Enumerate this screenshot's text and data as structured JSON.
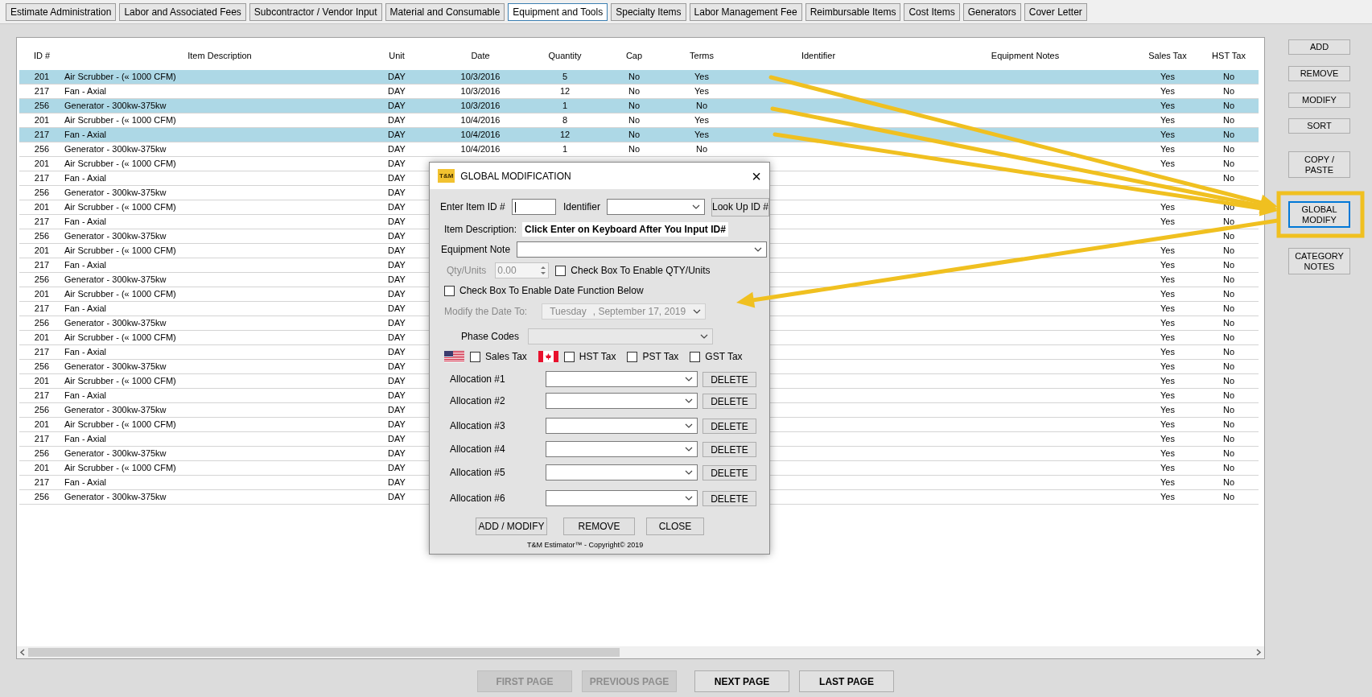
{
  "tabs": [
    {
      "label": "Estimate Administration",
      "selected": false
    },
    {
      "label": "Labor and Associated Fees",
      "selected": false
    },
    {
      "label": "Subcontractor / Vendor Input",
      "selected": false
    },
    {
      "label": "Material and Consumable",
      "selected": false
    },
    {
      "label": "Equipment and Tools",
      "selected": true
    },
    {
      "label": "Specialty Items",
      "selected": false
    },
    {
      "label": "Labor Management Fee",
      "selected": false
    },
    {
      "label": "Reimbursable Items",
      "selected": false
    },
    {
      "label": "Cost Items",
      "selected": false
    },
    {
      "label": "Generators",
      "selected": false
    },
    {
      "label": "Cover Letter",
      "selected": false
    }
  ],
  "table": {
    "columns": [
      "ID #",
      "Item Description",
      "Unit",
      "Date",
      "Quantity",
      "Cap",
      "Terms",
      "Identifier",
      "Equipment Notes",
      "Sales Tax",
      "HST Tax"
    ],
    "rows": [
      {
        "id": "201",
        "description": "Air Scrubber - (« 1000 CFM)",
        "unit": "DAY",
        "date": "10/3/2016",
        "quantity": "5",
        "cap": "No",
        "terms": "Yes",
        "sales_tax": "Yes",
        "hst_tax": "No",
        "selected": true
      },
      {
        "id": "217",
        "description": "Fan - Axial",
        "unit": "DAY",
        "date": "10/3/2016",
        "quantity": "12",
        "cap": "No",
        "terms": "Yes",
        "sales_tax": "Yes",
        "hst_tax": "No",
        "selected": false
      },
      {
        "id": "256",
        "description": "Generator - 300kw-375kw",
        "unit": "DAY",
        "date": "10/3/2016",
        "quantity": "1",
        "cap": "No",
        "terms": "No",
        "sales_tax": "Yes",
        "hst_tax": "No",
        "selected": true
      },
      {
        "id": "201",
        "description": "Air Scrubber - (« 1000 CFM)",
        "unit": "DAY",
        "date": "10/4/2016",
        "quantity": "8",
        "cap": "No",
        "terms": "Yes",
        "sales_tax": "Yes",
        "hst_tax": "No",
        "selected": false
      },
      {
        "id": "217",
        "description": "Fan - Axial",
        "unit": "DAY",
        "date": "10/4/2016",
        "quantity": "12",
        "cap": "No",
        "terms": "Yes",
        "sales_tax": "Yes",
        "hst_tax": "No",
        "selected": true
      },
      {
        "id": "256",
        "description": "Generator - 300kw-375kw",
        "unit": "DAY",
        "date": "10/4/2016",
        "quantity": "1",
        "cap": "No",
        "terms": "No",
        "sales_tax": "Yes",
        "hst_tax": "No",
        "selected": false
      },
      {
        "id": "201",
        "description": "Air Scrubber - (« 1000 CFM)",
        "unit": "DAY",
        "sales_tax": "Yes",
        "hst_tax": "No",
        "selected": false
      },
      {
        "id": "217",
        "description": "Fan - Axial",
        "unit": "DAY",
        "hst_tax": "No",
        "selected": false
      },
      {
        "id": "256",
        "description": "Generator - 300kw-375kw",
        "unit": "DAY",
        "selected": false
      },
      {
        "id": "201",
        "description": "Air Scrubber - (« 1000 CFM)",
        "unit": "DAY",
        "sales_tax": "Yes",
        "hst_tax": "No",
        "selected": false
      },
      {
        "id": "217",
        "description": "Fan - Axial",
        "unit": "DAY",
        "sales_tax": "Yes",
        "hst_tax": "No",
        "selected": false
      },
      {
        "id": "256",
        "description": "Generator - 300kw-375kw",
        "unit": "DAY",
        "hst_tax": "No",
        "selected": false
      },
      {
        "id": "201",
        "description": "Air Scrubber - (« 1000 CFM)",
        "unit": "DAY",
        "sales_tax": "Yes",
        "hst_tax": "No",
        "selected": false
      },
      {
        "id": "217",
        "description": "Fan - Axial",
        "unit": "DAY",
        "sales_tax": "Yes",
        "hst_tax": "No",
        "selected": false
      },
      {
        "id": "256",
        "description": "Generator - 300kw-375kw",
        "unit": "DAY",
        "sales_tax": "Yes",
        "hst_tax": "No",
        "selected": false
      },
      {
        "id": "201",
        "description": "Air Scrubber - (« 1000 CFM)",
        "unit": "DAY",
        "sales_tax": "Yes",
        "hst_tax": "No",
        "selected": false
      },
      {
        "id": "217",
        "description": "Fan - Axial",
        "unit": "DAY",
        "sales_tax": "Yes",
        "hst_tax": "No",
        "selected": false
      },
      {
        "id": "256",
        "description": "Generator - 300kw-375kw",
        "unit": "DAY",
        "sales_tax": "Yes",
        "hst_tax": "No",
        "selected": false
      },
      {
        "id": "201",
        "description": "Air Scrubber - (« 1000 CFM)",
        "unit": "DAY",
        "sales_tax": "Yes",
        "hst_tax": "No",
        "selected": false
      },
      {
        "id": "217",
        "description": "Fan - Axial",
        "unit": "DAY",
        "sales_tax": "Yes",
        "hst_tax": "No",
        "selected": false
      },
      {
        "id": "256",
        "description": "Generator - 300kw-375kw",
        "unit": "DAY",
        "sales_tax": "Yes",
        "hst_tax": "No",
        "selected": false
      },
      {
        "id": "201",
        "description": "Air Scrubber - (« 1000 CFM)",
        "unit": "DAY",
        "sales_tax": "Yes",
        "hst_tax": "No",
        "selected": false
      },
      {
        "id": "217",
        "description": "Fan - Axial",
        "unit": "DAY",
        "sales_tax": "Yes",
        "hst_tax": "No",
        "selected": false
      },
      {
        "id": "256",
        "description": "Generator - 300kw-375kw",
        "unit": "DAY",
        "sales_tax": "Yes",
        "hst_tax": "No",
        "selected": false
      },
      {
        "id": "201",
        "description": "Air Scrubber - (« 1000 CFM)",
        "unit": "DAY",
        "sales_tax": "Yes",
        "hst_tax": "No",
        "selected": false
      },
      {
        "id": "217",
        "description": "Fan - Axial",
        "unit": "DAY",
        "sales_tax": "Yes",
        "hst_tax": "No",
        "selected": false
      },
      {
        "id": "256",
        "description": "Generator - 300kw-375kw",
        "unit": "DAY",
        "sales_tax": "Yes",
        "hst_tax": "No",
        "selected": false
      },
      {
        "id": "201",
        "description": "Air Scrubber - (« 1000 CFM)",
        "unit": "DAY",
        "sales_tax": "Yes",
        "hst_tax": "No",
        "selected": false
      },
      {
        "id": "217",
        "description": "Fan - Axial",
        "unit": "DAY",
        "sales_tax": "Yes",
        "hst_tax": "No",
        "selected": false
      },
      {
        "id": "256",
        "description": "Generator - 300kw-375kw",
        "unit": "DAY",
        "sales_tax": "Yes",
        "hst_tax": "No",
        "selected": false
      }
    ]
  },
  "side_buttons": [
    {
      "lines": [
        "ADD"
      ],
      "focused": false
    },
    {
      "lines": [
        "REMOVE"
      ],
      "focused": false
    },
    {
      "lines": [
        "MODIFY"
      ],
      "focused": false
    },
    {
      "lines": [
        "SORT"
      ],
      "focused": false
    },
    {
      "lines": [
        "COPY /",
        "PASTE"
      ],
      "focused": false
    },
    {
      "lines": [
        "GLOBAL",
        "MODIFY"
      ],
      "focused": true
    },
    {
      "lines": [
        "CATEGORY",
        "NOTES"
      ],
      "focused": false
    }
  ],
  "pager": [
    {
      "label": "FIRST PAGE",
      "disabled": true
    },
    {
      "label": "PREVIOUS PAGE",
      "disabled": true
    },
    {
      "label": "NEXT PAGE",
      "disabled": false
    },
    {
      "label": "LAST PAGE",
      "disabled": false
    }
  ],
  "dialog": {
    "logo": "T&M",
    "title": "GLOBAL MODIFICATION",
    "close": "×",
    "item_id_label": "Enter Item ID #",
    "identifier_label": "Identifier",
    "lookup_button": "Look Up ID #",
    "item_description_label": "Item Description:",
    "item_description_value": "Click Enter on Keyboard After You Input ID#",
    "equipment_note_label": "Equipment Note",
    "qty": {
      "label": "Qty/Units",
      "value": "0.00",
      "disabled": true
    },
    "qty_checkbox": {
      "label": "Check Box To Enable QTY/Units",
      "checked": false
    },
    "date_checkbox": {
      "label": "Check Box To Enable Date Function Below",
      "checked": false
    },
    "date": {
      "label": "Modify the Date To:",
      "day": "Tuesday",
      "rest": ", September 17, 2019",
      "disabled": true
    },
    "phase_codes_label": "Phase Codes",
    "taxes": [
      {
        "label": "Sales Tax",
        "checked": false,
        "kind": "us"
      },
      {
        "label": "HST Tax",
        "checked": false,
        "kind": "ca"
      },
      {
        "label": "PST Tax",
        "checked": false,
        "kind": "plain"
      },
      {
        "label": "GST Tax",
        "checked": false,
        "kind": "plain"
      }
    ],
    "allocations": [
      {
        "label": "Allocation #1",
        "button": "DELETE"
      },
      {
        "label": "Allocation #2",
        "button": "DELETE"
      },
      {
        "label": "Allocation #3",
        "button": "DELETE"
      },
      {
        "label": "Allocation #4",
        "button": "DELETE"
      },
      {
        "label": "Allocation #5",
        "button": "DELETE"
      },
      {
        "label": "Allocation #6",
        "button": "DELETE"
      }
    ],
    "buttons": [
      "ADD / MODIFY",
      "REMOVE",
      "CLOSE"
    ],
    "footer": "T&M Estimator™ - Copyright© 2019"
  }
}
